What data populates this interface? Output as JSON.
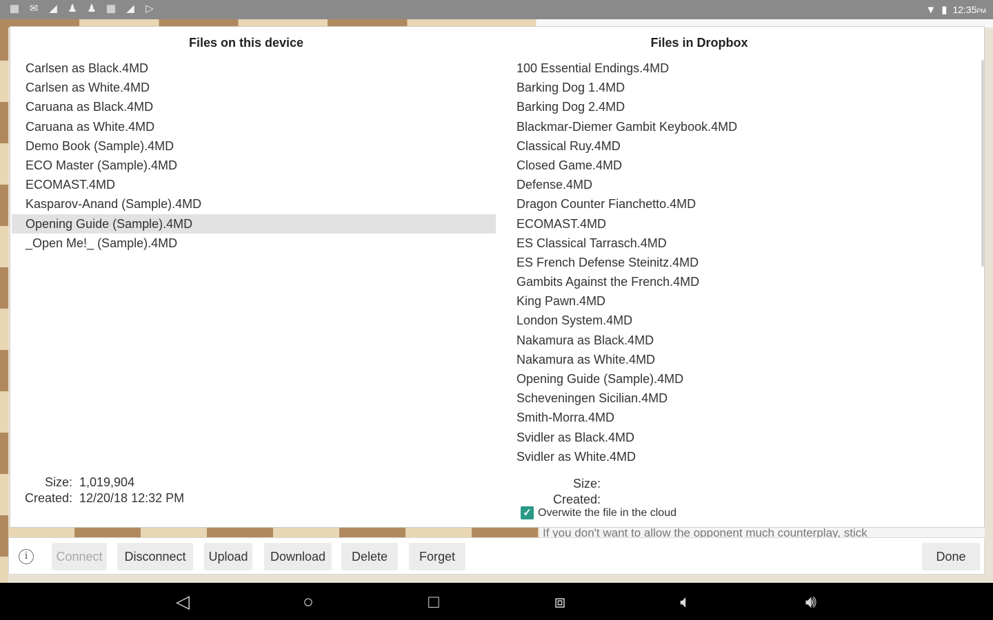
{
  "status_bar": {
    "left_icons": [
      "calendar-icon",
      "mail-icon",
      "signal-icon",
      "pawn-icon",
      "pawn-icon",
      "calendar-icon",
      "signal-icon",
      "play-store-icon"
    ],
    "time": "12:35",
    "ampm": "PM"
  },
  "dialog": {
    "local": {
      "title": "Files on this device",
      "files": [
        "Carlsen as Black.4MD",
        "Carlsen as White.4MD",
        "Caruana as Black.4MD",
        "Caruana as White.4MD",
        "Demo Book (Sample).4MD",
        "ECO Master (Sample).4MD",
        "ECOMAST.4MD",
        "Kasparov-Anand (Sample).4MD",
        "Opening Guide (Sample).4MD",
        "_Open Me!_ (Sample).4MD"
      ],
      "selected_index": 8,
      "size_label": "Size:",
      "size_value": "1,019,904",
      "created_label": "Created:",
      "created_value": "12/20/18 12:32 PM"
    },
    "dropbox": {
      "title": "Files in Dropbox",
      "files": [
        "100 Essential Endings.4MD",
        "Barking Dog 1.4MD",
        "Barking Dog 2.4MD",
        "Blackmar-Diemer Gambit Keybook.4MD",
        "Classical Ruy.4MD",
        "Closed Game.4MD",
        "Defense.4MD",
        "Dragon Counter Fianchetto.4MD",
        "ECOMAST.4MD",
        "ES Classical Tarrasch.4MD",
        "ES French Defense Steinitz.4MD",
        "Gambits Against the French.4MD",
        "King  Pawn.4MD",
        "London System.4MD",
        "Nakamura as Black.4MD",
        "Nakamura as White.4MD",
        "Opening Guide (Sample).4MD",
        "Scheveningen Sicilian.4MD",
        "Smith-Morra.4MD",
        "Svidler as Black.4MD",
        "Svidler as White.4MD"
      ],
      "size_label": "Size:",
      "created_label": "Created:",
      "overwrite_label": "Overwite the file in the cloud",
      "overwrite_checked": true
    }
  },
  "background_commentary": "If you don't want to allow the opponent much counterplay, stick",
  "toolbar": {
    "connect": "Connect",
    "disconnect": "Disconnect",
    "upload": "Upload",
    "download": "Download",
    "delete": "Delete",
    "forget": "Forget",
    "done": "Done"
  },
  "colors": {
    "accent": "#2a9a86",
    "status_bar": "#8a8a8a",
    "selection": "#e2e2e2"
  }
}
